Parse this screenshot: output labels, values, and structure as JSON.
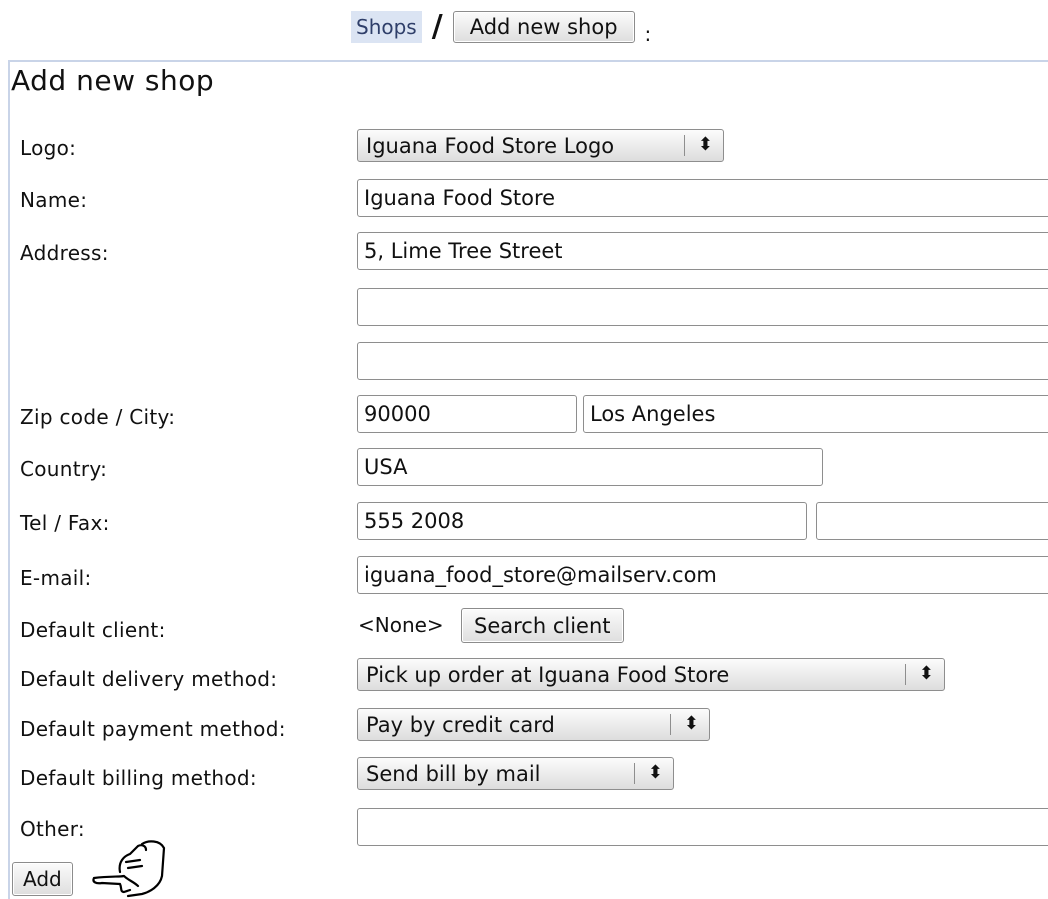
{
  "breadcrumb": {
    "shops": "Shops",
    "separator": "/",
    "add_button": "Add new shop",
    "end": ":"
  },
  "form": {
    "title": "Add new shop",
    "labels": {
      "logo": "Logo:",
      "name": "Name:",
      "address": "Address:",
      "zip_city": "Zip code / City:",
      "country": "Country:",
      "tel_fax": "Tel / Fax:",
      "email": "E-mail:",
      "default_client": "Default client:",
      "delivery": "Default delivery method:",
      "payment": "Default payment method:",
      "billing": "Default billing method:",
      "other": "Other:"
    },
    "values": {
      "logo": "Iguana Food Store Logo",
      "name": "Iguana Food Store",
      "address1": "5, Lime Tree Street",
      "address2": "",
      "address3": "",
      "zip": "90000",
      "city": "Los Angeles",
      "country": "USA",
      "tel": "555 2008",
      "fax": "",
      "email": "iguana_food_store@mailserv.com",
      "default_client": "<None>",
      "delivery": "Pick up order at Iguana Food Store",
      "payment": "Pay by credit card",
      "billing": "Send bill by mail",
      "other": ""
    },
    "search_client_button": "Search client",
    "add_button": "Add"
  },
  "icons": {
    "select_arrows": "updown-arrows-icon",
    "pointer": "hand-pointer-icon"
  }
}
